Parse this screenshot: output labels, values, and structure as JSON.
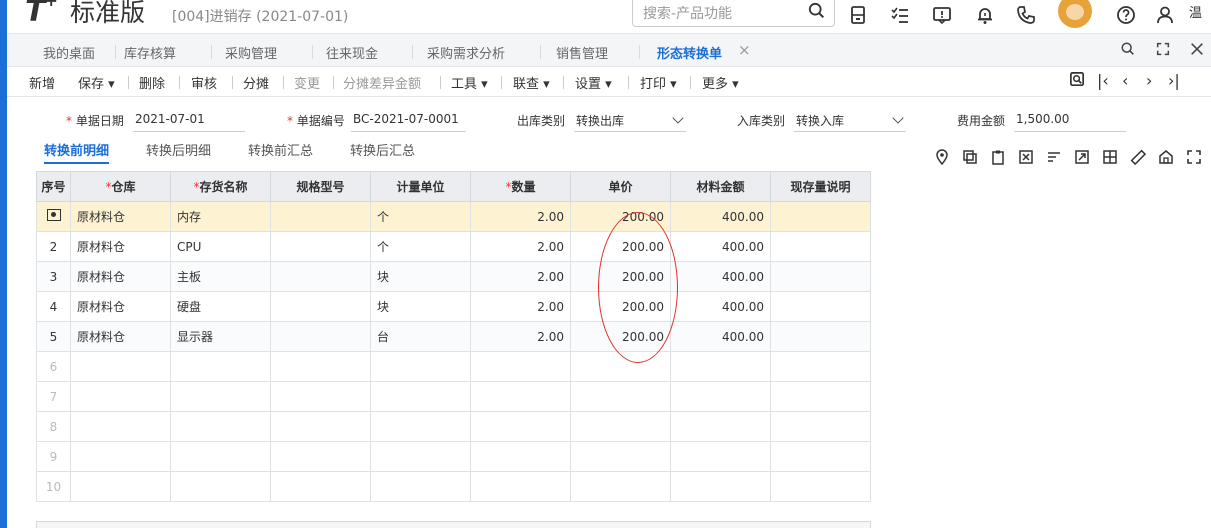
{
  "header": {
    "logo_t": "T",
    "logo_plus": "+",
    "edition": "标准版",
    "account": "[004]进销存 (2021-07-01)",
    "search_placeholder": "搜索-产品功能",
    "user": "温",
    "icons": [
      "calculator-icon",
      "checklist-icon",
      "message-icon",
      "bell-icon",
      "phone-icon",
      "avatar",
      "help-icon",
      "user-icon"
    ]
  },
  "tabs": {
    "items": [
      "我的桌面",
      "库存核算",
      "采购管理",
      "往来现金",
      "采购需求分析",
      "销售管理",
      "形态转换单"
    ],
    "active": "形态转换单",
    "close": "×"
  },
  "toolbar": {
    "new": "新增",
    "save": "保存",
    "delete": "删除",
    "audit": "审核",
    "split": "分摊",
    "change": "变更",
    "split_diff": "分摊差异金额",
    "tools": "工具",
    "link": "联查",
    "settings": "设置",
    "print": "打印",
    "more": "更多"
  },
  "form": {
    "date_label": "单据日期",
    "date_value": "2021-07-01",
    "code_label": "单据编号",
    "code_value": "BC-2021-07-0001",
    "out_label": "出库类别",
    "out_value": "转换出库",
    "in_label": "入库类别",
    "in_value": "转换入库",
    "fee_label": "费用金额",
    "fee_value": "1,500.00",
    "req_mark": "*"
  },
  "subtabs": [
    "转换前明细",
    "转换后明细",
    "转换前汇总",
    "转换后汇总"
  ],
  "grid": {
    "headers": [
      "序号",
      "仓库",
      "存货名称",
      "规格型号",
      "计量单位",
      "数量",
      "单价",
      "材料金额",
      "现存量说明"
    ],
    "rows": [
      {
        "idx": "",
        "wh": "原材料仓",
        "name": "内存",
        "spec": "",
        "unit": "个",
        "qty": "2.00",
        "price": "200.00",
        "amount": "400.00",
        "note": ""
      },
      {
        "idx": "2",
        "wh": "原材料仓",
        "name": "CPU",
        "spec": "",
        "unit": "个",
        "qty": "2.00",
        "price": "200.00",
        "amount": "400.00",
        "note": ""
      },
      {
        "idx": "3",
        "wh": "原材料仓",
        "name": "主板",
        "spec": "",
        "unit": "块",
        "qty": "2.00",
        "price": "200.00",
        "amount": "400.00",
        "note": ""
      },
      {
        "idx": "4",
        "wh": "原材料仓",
        "name": "硬盘",
        "spec": "",
        "unit": "块",
        "qty": "2.00",
        "price": "200.00",
        "amount": "400.00",
        "note": ""
      },
      {
        "idx": "5",
        "wh": "原材料仓",
        "name": "显示器",
        "spec": "",
        "unit": "台",
        "qty": "2.00",
        "price": "200.00",
        "amount": "400.00",
        "note": ""
      }
    ],
    "empty_rows": [
      "6",
      "7",
      "8",
      "9",
      "10"
    ]
  },
  "colors": {
    "accent": "#1b6fd6",
    "required": "#e33333",
    "selected_row": "#fdf3d3",
    "annotation": "#e03030"
  }
}
